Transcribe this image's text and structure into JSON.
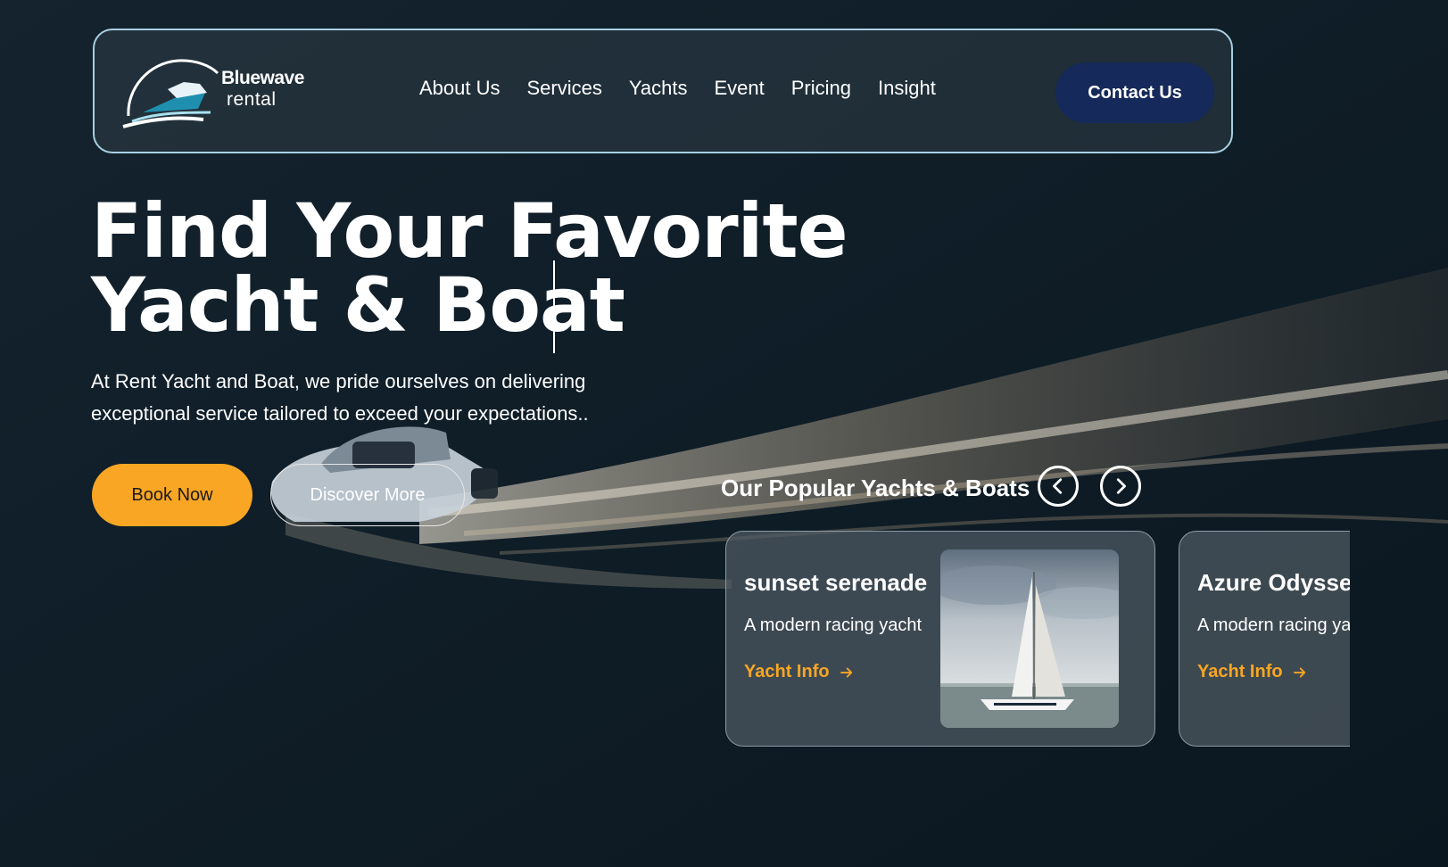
{
  "brand": {
    "name_line1": "Bluewave",
    "name_line2": "rental"
  },
  "nav": {
    "items": [
      "About Us",
      "Services",
      "Yachts",
      "Event",
      "Pricing",
      "Insight"
    ],
    "contact_label": "Contact Us"
  },
  "hero": {
    "title_line1": "Find Your Favorite",
    "title_line2": "Yacht & Boat",
    "description": "At Rent Yacht and Boat, we pride ourselves on delivering exceptional service tailored to exceed your expectations..",
    "book_label": "Book Now",
    "discover_label": "Discover More"
  },
  "popular": {
    "title": "Our Popular Yachts & Boats",
    "cards": [
      {
        "name": "sunset serenade",
        "description": "A modern racing yacht",
        "link_label": "Yacht Info"
      },
      {
        "name": "Azure Odyssey",
        "description": "A modern racing yacht",
        "link_label": "Yacht Info"
      }
    ]
  },
  "colors": {
    "accent": "#f8a623",
    "contact_bg": "#15295a",
    "nav_border": "#a9cfe3"
  },
  "icons": {
    "prev": "chevron-left-icon",
    "next": "chevron-right-icon",
    "link_arrow": "arrow-right-icon",
    "logo": "boat-logo-icon"
  }
}
